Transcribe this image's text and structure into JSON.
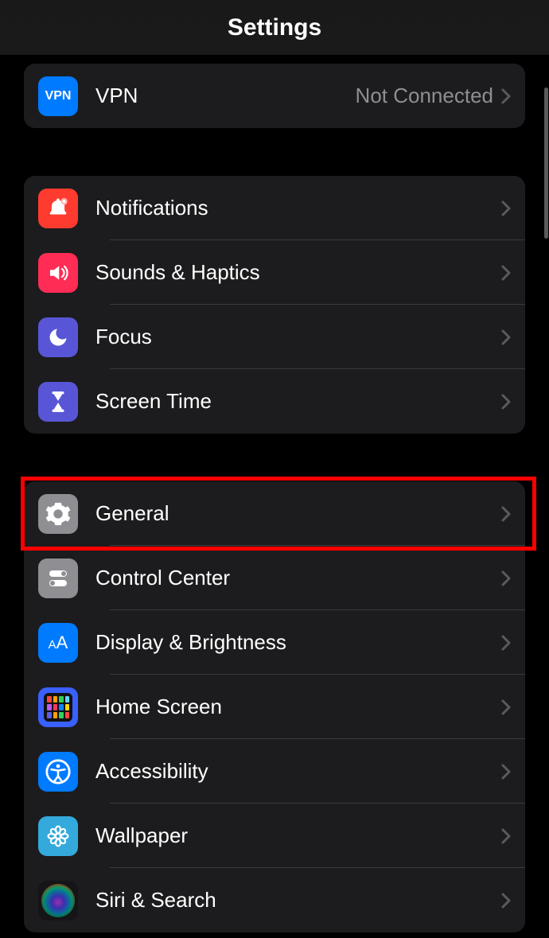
{
  "header": {
    "title": "Settings"
  },
  "groups": [
    {
      "rows": [
        {
          "id": "vpn",
          "label": "VPN",
          "value": "Not Connected",
          "icon_bg": "#007aff"
        }
      ]
    },
    {
      "rows": [
        {
          "id": "notifications",
          "label": "Notifications",
          "icon_bg": "#ff3b30"
        },
        {
          "id": "sounds",
          "label": "Sounds & Haptics",
          "icon_bg": "#ff2d55"
        },
        {
          "id": "focus",
          "label": "Focus",
          "icon_bg": "#5856d6"
        },
        {
          "id": "screentime",
          "label": "Screen Time",
          "icon_bg": "#5856d6"
        }
      ]
    },
    {
      "rows": [
        {
          "id": "general",
          "label": "General",
          "icon_bg": "#8e8e93",
          "highlighted": true
        },
        {
          "id": "controlcenter",
          "label": "Control Center",
          "icon_bg": "#8e8e93"
        },
        {
          "id": "display",
          "label": "Display & Brightness",
          "icon_bg": "#007aff"
        },
        {
          "id": "homescreen",
          "label": "Home Screen",
          "icon_bg": "#3a60ff"
        },
        {
          "id": "accessibility",
          "label": "Accessibility",
          "icon_bg": "#007aff"
        },
        {
          "id": "wallpaper",
          "label": "Wallpaper",
          "icon_bg": "#34aadc"
        },
        {
          "id": "siri",
          "label": "Siri & Search",
          "icon_bg": "#1c1c1e"
        }
      ]
    }
  ],
  "highlight_target": "general"
}
